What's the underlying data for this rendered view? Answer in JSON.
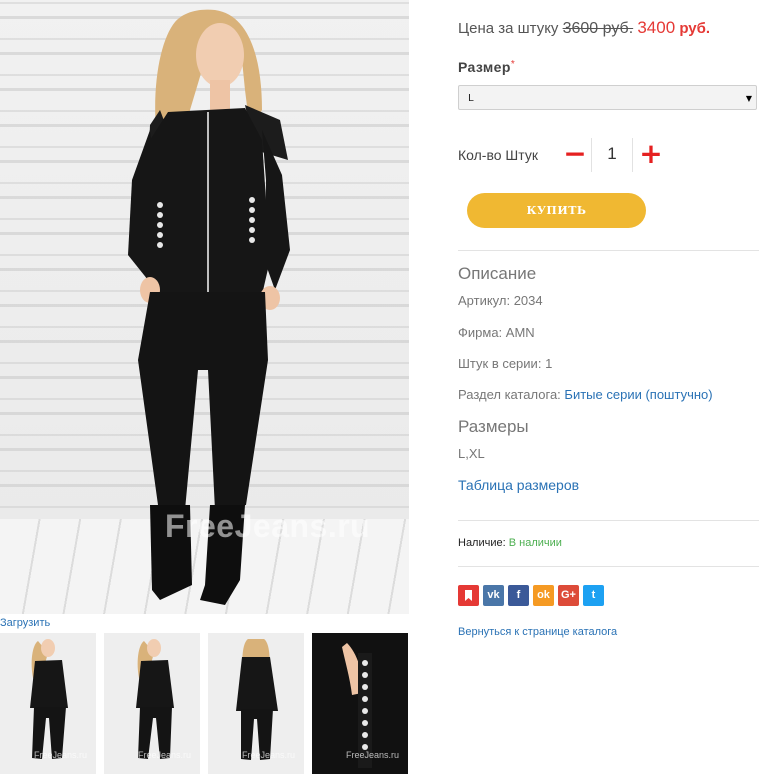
{
  "gallery": {
    "main_image_watermark": "FreeJeans.ru",
    "upload_link": "Загрузить",
    "thumbnails": [
      {
        "watermark": "FreeJeans.ru"
      },
      {
        "watermark": "FreeJeans.ru"
      },
      {
        "watermark": "FreeJeans.ru"
      },
      {
        "watermark": "FreeJeans.ru"
      }
    ]
  },
  "product": {
    "price_label": "Цена за штуку",
    "price_old": "3600 руб.",
    "price_new": "3400",
    "price_currency": "руб.",
    "size_label": "Размер",
    "size_required_mark": "*",
    "size_selected": "L",
    "qty_label": "Кол-во Штук",
    "qty_value": "1",
    "qty_minus": "−",
    "qty_plus": "+",
    "buy_label": "КУПИТЬ"
  },
  "description": {
    "title": "Описание",
    "article_label": "Артикул:",
    "article_value": "2034",
    "brand_label": "Фирма:",
    "brand_value": "AMN",
    "series_label": "Штук в серии:",
    "series_value": "1",
    "catalog_label": "Раздел каталога:",
    "catalog_link": "Битые серии (поштучно)",
    "sizes_title": "Размеры",
    "sizes_value": "L,XL",
    "size_table_link": "Таблица размеров"
  },
  "availability": {
    "label": "Наличие:",
    "value": "В наличии"
  },
  "share": {
    "buttons": [
      {
        "icon": "bookmark-icon",
        "glyph": "▮",
        "color": "#e53935"
      },
      {
        "icon": "vk-icon",
        "glyph": "vk",
        "color": "#4a76a8"
      },
      {
        "icon": "facebook-icon",
        "glyph": "f",
        "color": "#3b5998"
      },
      {
        "icon": "odnoklassniki-icon",
        "glyph": "ok",
        "color": "#f59a23"
      },
      {
        "icon": "google-plus-icon",
        "glyph": "G+",
        "color": "#dd4b39"
      },
      {
        "icon": "twitter-icon",
        "glyph": "t",
        "color": "#1da1f2"
      }
    ]
  },
  "back_link": "Вернуться к странице каталога"
}
